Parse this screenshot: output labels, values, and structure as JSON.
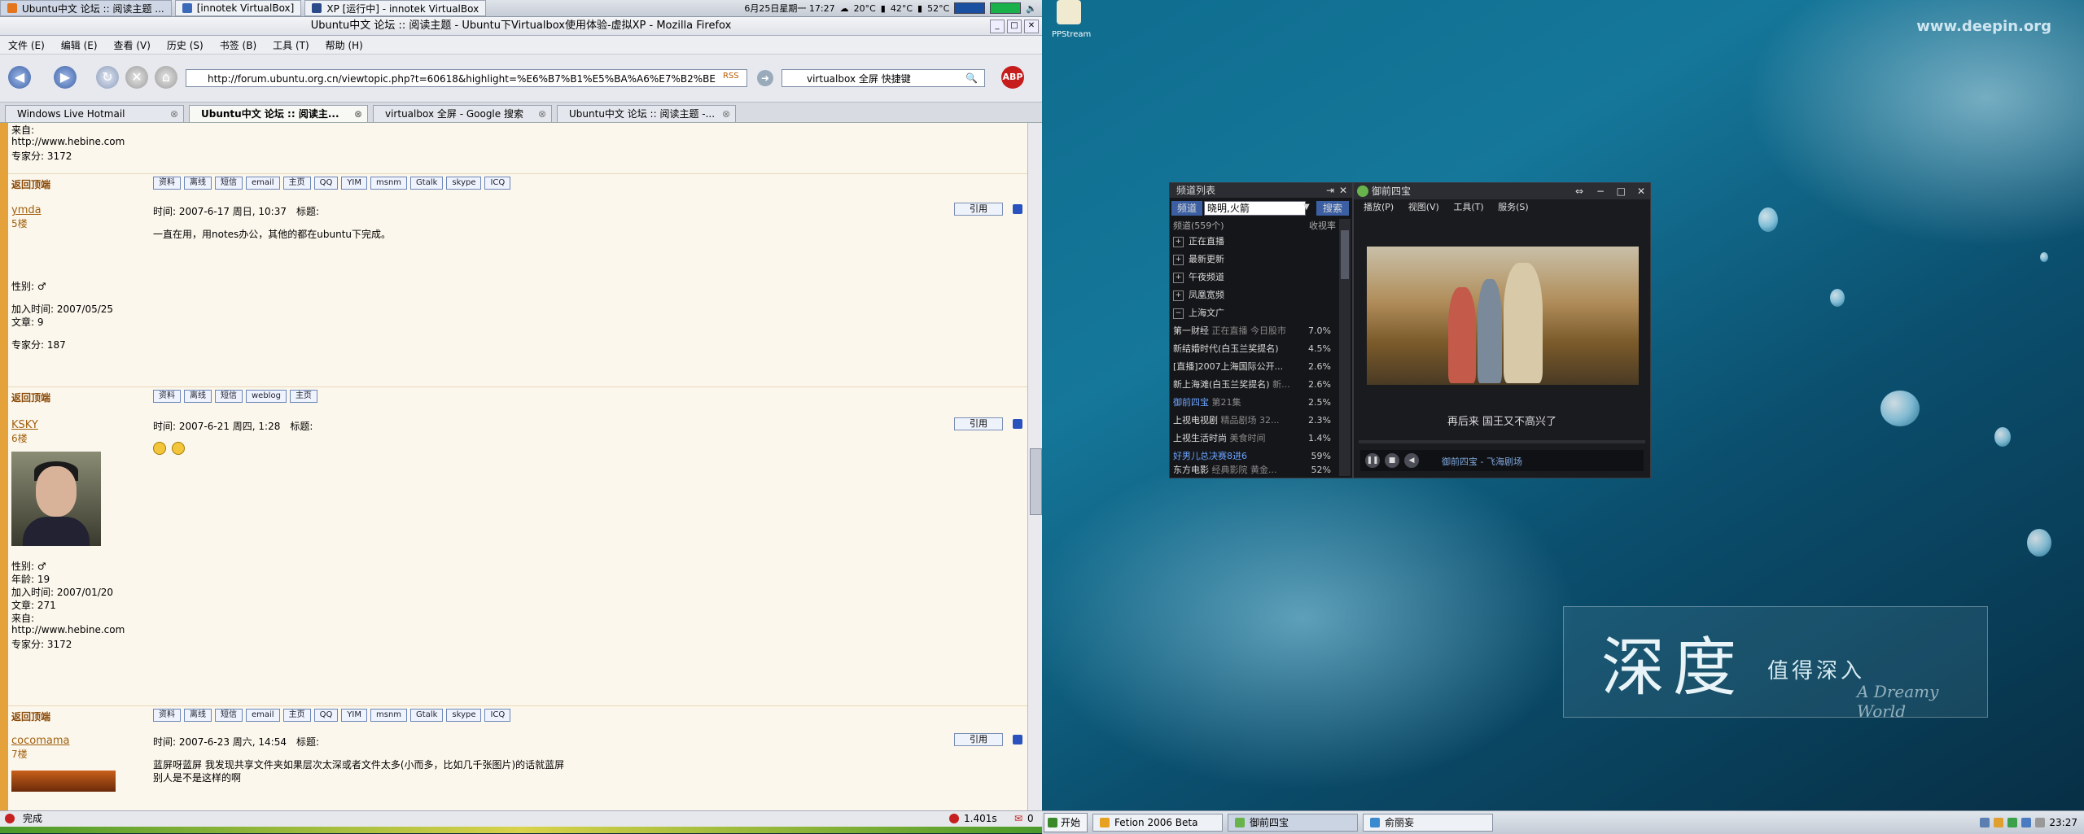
{
  "taskbar_top": {
    "tasks": [
      {
        "label": "Ubuntu中文 论坛 :: 阅读主题 ..."
      },
      {
        "label": "[innotek VirtualBox]"
      },
      {
        "label": "XP [运行中] - innotek VirtualBox"
      }
    ],
    "tray": {
      "datetime": "6月25日星期一 17:27",
      "weather": "20°C",
      "temp1": "42°C",
      "temp2": "52°C"
    }
  },
  "firefox": {
    "title": "Ubuntu中文 论坛 :: 阅读主题 - Ubuntu下Virtualbox使用体验-虚拟XP - Mozilla Firefox",
    "menu": [
      "文件 (E)",
      "编辑 (E)",
      "查看 (V)",
      "历史 (S)",
      "书签 (B)",
      "工具 (T)",
      "帮助 (H)"
    ],
    "url": "http://forum.ubuntu.org.cn/viewtopic.php?t=60618&highlight=%E6%B7%B1%E5%BA%A6%E7%B2%BE",
    "rss": "RSS",
    "search_value": "virtualbox 全屏 快捷键",
    "abp": "ABP",
    "tabs": [
      {
        "label": "Windows Live Hotmail"
      },
      {
        "label": "Ubuntu中文 论坛 :: 阅读主..."
      },
      {
        "label": "virtualbox 全屏 - Google 搜索"
      },
      {
        "label": "Ubuntu中文 论坛 :: 阅读主题 -..."
      }
    ],
    "status": "完成",
    "status_time": "1.401s",
    "status_count": "0"
  },
  "forum": {
    "back_top": "返回顶端",
    "quote": "引用",
    "buttons_full": [
      "资料",
      "离线",
      "短信",
      "email",
      "主页",
      "QQ",
      "YIM",
      "msnm",
      "Gtalk",
      "skype",
      "ICQ"
    ],
    "buttons_short": [
      "资料",
      "离线",
      "短信",
      "weblog",
      "主页"
    ],
    "post0": {
      "l1": "来自:",
      "l2": "http://www.hebine.com",
      "l3": "专家分: 3172"
    },
    "post1": {
      "author": "ymda",
      "floor": "5楼",
      "meta": "时间: 2007-6-17 周日, 10:37　标题:",
      "body": "一直在用，用notes办公，其他的都在ubuntu下完成。",
      "gender": "性别: ♂",
      "joined": "加入时间: 2007/05/25",
      "posts": "文章: 9",
      "score": "专家分: 187"
    },
    "post2": {
      "author": "KSKY",
      "floor": "6楼",
      "meta": "时间: 2007-6-21 周四, 1:28　标题:",
      "gender": "性别: ♂",
      "age": "年龄: 19",
      "joined": "加入时间: 2007/01/20",
      "posts": "文章: 271",
      "from": "来自:",
      "site": "http://www.hebine.com",
      "score": "专家分: 3172"
    },
    "post3": {
      "author": "cocomama",
      "floor": "7楼",
      "meta": "时间: 2007-6-23 周六, 14:54　标题:",
      "body1": "蓝屏呀蓝屏 我发现共享文件夹如果层次太深或者文件太多(小而多，比如几千张图片)的话就蓝屏",
      "body2": "别人是不是这样的啊"
    }
  },
  "desktop": {
    "url_text": "www.deepin.org",
    "logo_big": "深度",
    "logo_sub": "值得深入",
    "logo_script": "A Dreamy World",
    "icon_label": "PPStream"
  },
  "chanlist": {
    "title": "频道列表",
    "search_label": "频道",
    "search_value": "晓明,火箭",
    "search_btn": "搜索",
    "col_left": "频道(559个)",
    "col_right": "收视率",
    "groups": [
      "正在直播",
      "最新更新",
      "午夜频道",
      "凤凰宽频",
      "上海文广"
    ],
    "rows": [
      {
        "name": "第一财经",
        "sub": "正在直播 今日股市",
        "pct": "7.0%"
      },
      {
        "name": "新结婚时代(白玉兰奖提名)",
        "sub": "",
        "pct": "4.5%"
      },
      {
        "name": "[直播]2007上海国际公开...",
        "sub": "",
        "pct": "2.6%"
      },
      {
        "name": "新上海滩(白玉兰奖提名)",
        "sub": "新...",
        "pct": "2.6%"
      },
      {
        "name": "御前四宝",
        "sub": "第21集",
        "pct": "2.5%"
      },
      {
        "name": "上视电视剧",
        "sub": "精品剧场 32...",
        "pct": "2.3%"
      },
      {
        "name": "上视生活时尚",
        "sub": "美食时间",
        "pct": "1.4%"
      },
      {
        "name": "好男儿总决赛8进6",
        "sub": "",
        "pct": "59%"
      },
      {
        "name": "东方电影",
        "sub": "经典影院 黄金...",
        "pct": "52%"
      }
    ]
  },
  "player": {
    "title": "御前四宝",
    "menu": [
      "播放(P)",
      "视图(V)",
      "工具(T)",
      "服务(S)"
    ],
    "subtitle": "再后来 国王又不高兴了",
    "nowplaying": "御前四宝 - 飞海剧场"
  },
  "taskbar_bottom": {
    "start": "开始",
    "tasks": [
      {
        "label": "Fetion 2006 Beta"
      },
      {
        "label": "御前四宝"
      },
      {
        "label": "俞丽妄"
      }
    ],
    "clock": "23:27"
  }
}
